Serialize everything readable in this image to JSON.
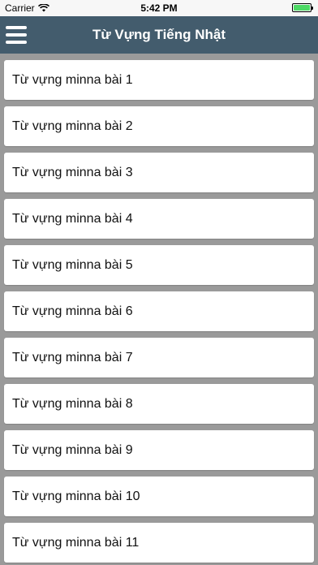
{
  "status_bar": {
    "carrier": "Carrier",
    "time": "5:42 PM",
    "wifi_icon": "wifi-icon",
    "battery_color": "#4cd964"
  },
  "nav_bar": {
    "title": "Từ Vựng Tiếng Nhật",
    "menu_icon": "hamburger-menu-icon",
    "background": "#435c6d"
  },
  "lessons": [
    "Từ vựng minna bài 1",
    "Từ vựng minna bài 2",
    "Từ vựng minna bài 3",
    "Từ vựng minna bài 4",
    "Từ vựng minna bài 5",
    "Từ vựng minna bài 6",
    "Từ vựng minna bài 7",
    "Từ vựng minna bài 8",
    "Từ vựng minna bài 9",
    "Từ vựng minna bài 10",
    "Từ vựng minna bài 11"
  ]
}
